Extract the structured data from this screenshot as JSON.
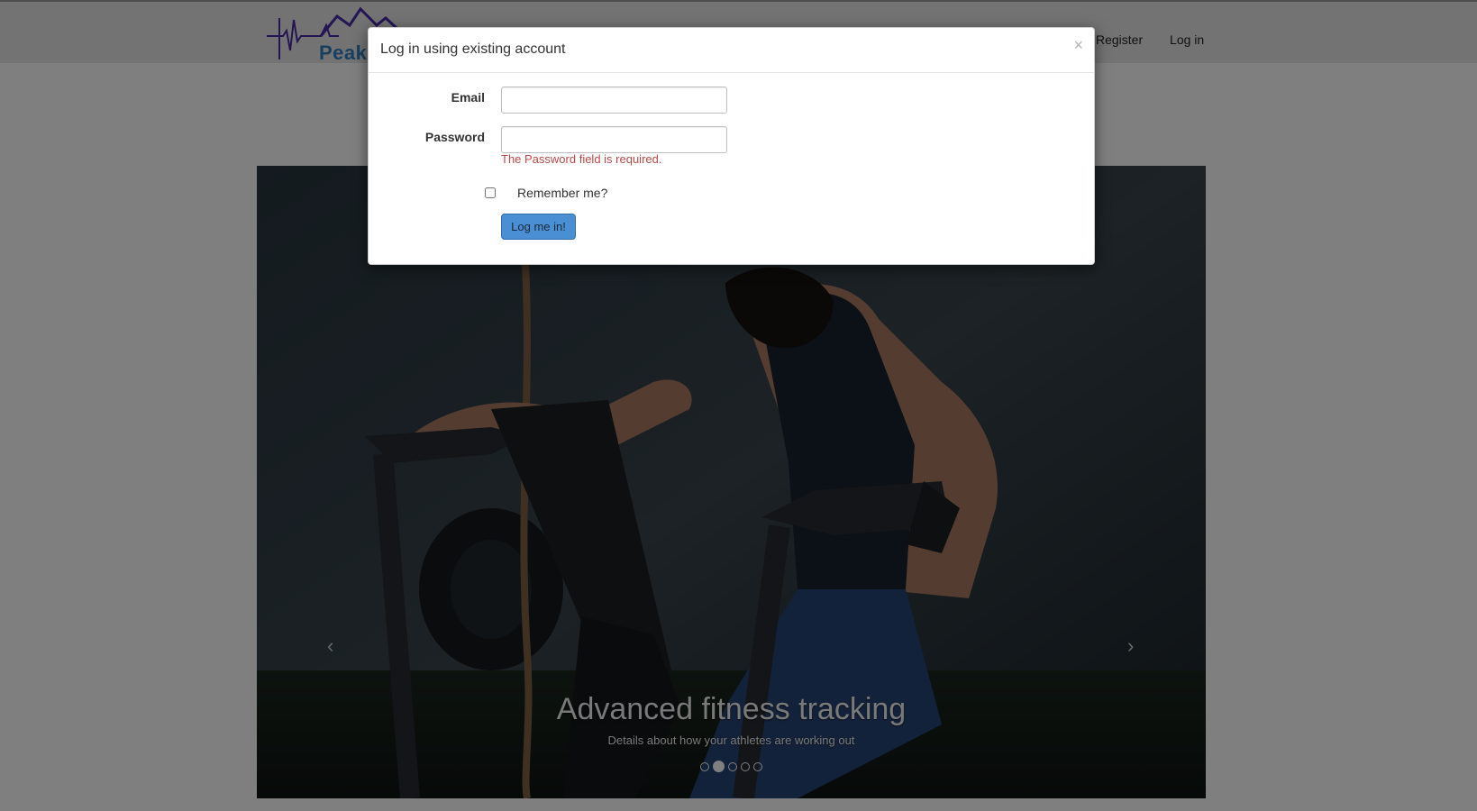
{
  "navbar": {
    "logo_text": "Peak",
    "links": [
      {
        "label": "Register"
      },
      {
        "label": "Log in"
      }
    ]
  },
  "carousel": {
    "caption_title": "Advanced fitness tracking",
    "caption_subtitle": "Details about how your athletes are working out",
    "prev_arrow": "‹",
    "next_arrow": "›",
    "slide_count": 5,
    "active_slide": 2
  },
  "modal": {
    "title": "Log in using existing account",
    "close_symbol": "×",
    "email_label": "Email",
    "email_value": "",
    "password_label": "Password",
    "password_value": "",
    "password_error": "The Password field is required.",
    "remember_label": "Remember me?",
    "remember_checked": false,
    "submit_label": "Log me in!"
  },
  "colors": {
    "brand_purple": "#4b2aa8",
    "brand_blue": "#2f7fbf",
    "button_primary": "#4a8ed3",
    "error_red": "#b94a48"
  }
}
